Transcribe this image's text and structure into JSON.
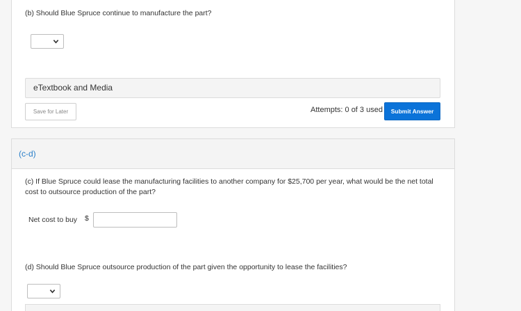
{
  "part_b": {
    "question": "(b) Should Blue Spruce continue to manufacture the part?",
    "dropdown_value": ""
  },
  "etextbook": {
    "label": "eTextbook and Media"
  },
  "actions": {
    "save_label": "Save for Later",
    "attempts_text": "Attempts: 0 of 3 used",
    "submit_label": "Submit Answer"
  },
  "part_cd": {
    "header_label": "(c-d)",
    "question_c_line1": "(c) If Blue Spruce could lease the manufacturing facilities to another company for $25,700 per year, what would be the net total",
    "question_c_line2": "cost to outsource production of the part?",
    "net_cost_label": "Net cost to buy",
    "currency_symbol": "$",
    "net_cost_value": "",
    "question_d": "(d) Should Blue Spruce outsource production of the part given the opportunity to lease the facilities?",
    "dropdown_value": ""
  },
  "colors": {
    "accent_blue": "#0b73d9",
    "part_label_blue": "#2a7fc9",
    "panel_gray": "#f4f4f4"
  }
}
